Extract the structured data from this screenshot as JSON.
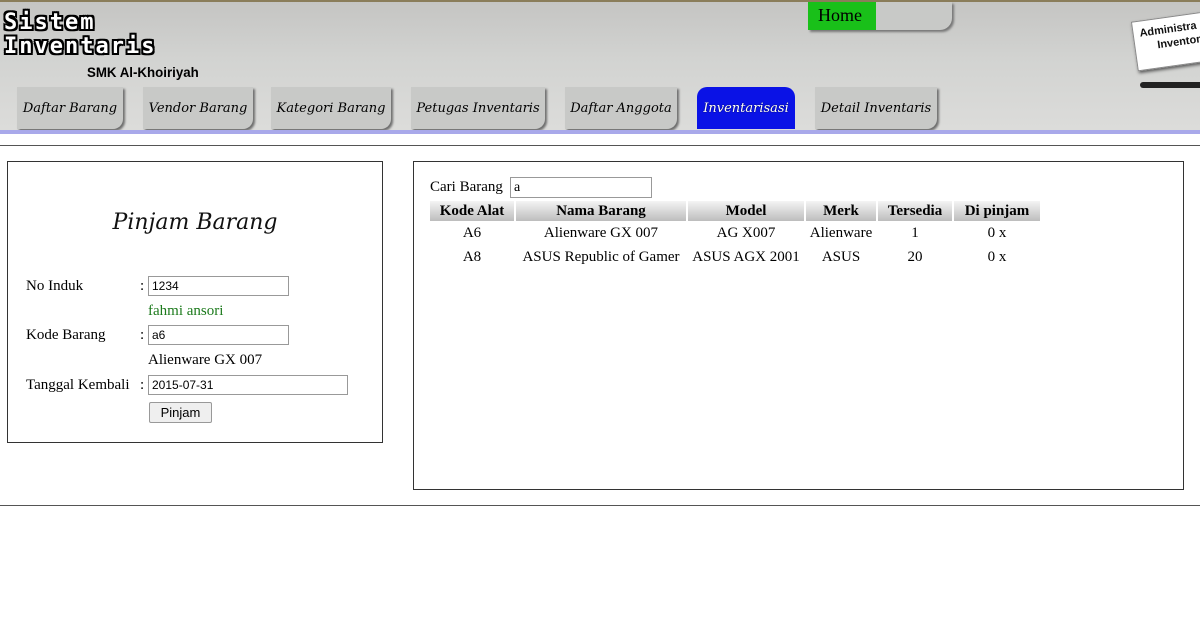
{
  "header": {
    "logo_line1": "Sistem",
    "logo_line2": "Inventaris",
    "logo_subtitle": "SMK Al-Khoiriyah",
    "home_label": "Home",
    "admin_badge_line1": "Administra",
    "admin_badge_line2": "Inventor"
  },
  "nav": {
    "tabs": [
      {
        "label": "Daftar Barang",
        "active": false
      },
      {
        "label": "Vendor Barang",
        "active": false
      },
      {
        "label": "Kategori Barang",
        "active": false
      },
      {
        "label": "Petugas Inventaris",
        "active": false
      },
      {
        "label": "Daftar Anggota",
        "active": false
      },
      {
        "label": "Inventarisasi",
        "active": true
      },
      {
        "label": "Detail Inventaris",
        "active": false
      }
    ]
  },
  "form": {
    "title": "Pinjam Barang",
    "no_induk_label": "No Induk",
    "no_induk_value": "1234",
    "no_induk_hint": "fahmi ansori",
    "kode_barang_label": "Kode Barang",
    "kode_barang_value": "a6",
    "kode_barang_hint": "Alienware GX 007",
    "tanggal_label": "Tanggal Kembali",
    "tanggal_value": "2015-07-31",
    "colon": ":",
    "submit_label": "Pinjam"
  },
  "search": {
    "label": "Cari Barang",
    "value": "a"
  },
  "table": {
    "headers": [
      "Kode Alat",
      "Nama Barang",
      "Model",
      "Merk",
      "Tersedia",
      "Di pinjam"
    ],
    "rows": [
      [
        "A6",
        "Alienware GX 007",
        "AG X007",
        "Alienware",
        "1",
        "0 x"
      ],
      [
        "A8",
        "ASUS Republic of Gamer",
        "ASUS AGX 2001",
        "ASUS",
        "20",
        "0 x"
      ]
    ]
  },
  "colors": {
    "home_green": "#19c019",
    "active_tab_blue": "#0a12e6",
    "nav_underline": "#a9a9ea",
    "hint_green": "#1c7a1c"
  }
}
